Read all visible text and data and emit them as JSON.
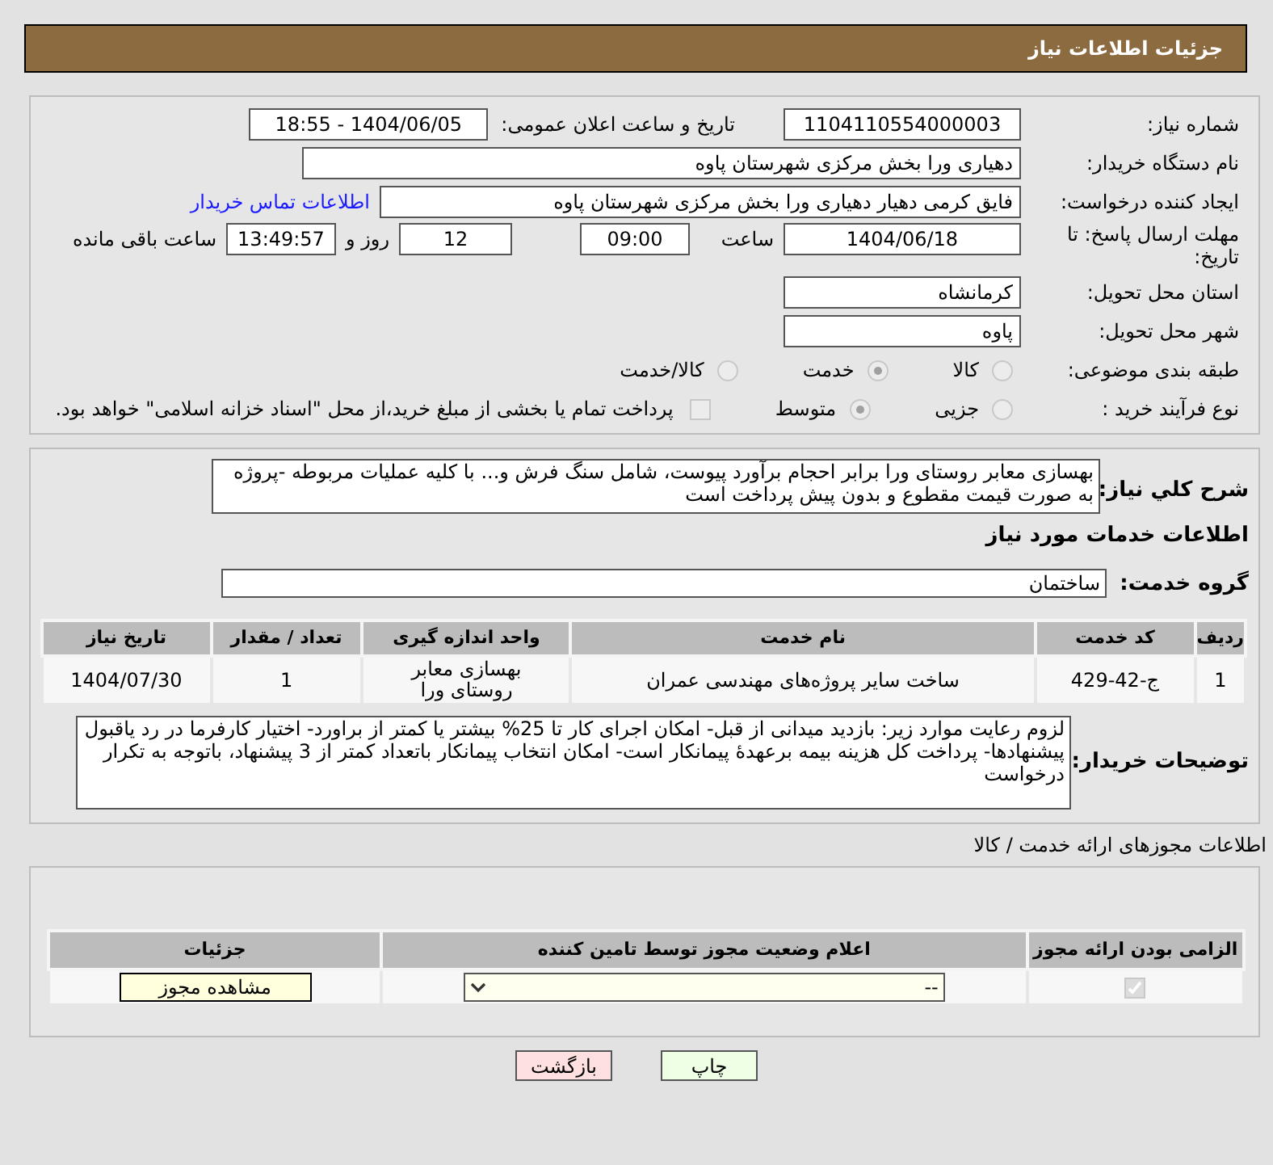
{
  "header": {
    "title": "جزئیات اطلاعات نیاز"
  },
  "need_number": {
    "label": "شماره نیاز:",
    "value": "1104110554000003"
  },
  "announce": {
    "label": "تاریخ و ساعت اعلان عمومی:",
    "value": "1404/06/05 - 18:55"
  },
  "buyer_org": {
    "label": "نام دستگاه خریدار:",
    "value": "دهیاری ورا بخش مرکزی شهرستان پاوه"
  },
  "requester": {
    "label": "ایجاد کننده درخواست:",
    "value": "فایق کرمی دهیار دهیاری ورا بخش مرکزی شهرستان پاوه",
    "link": "اطلاعات تماس خریدار"
  },
  "deadline": {
    "label": "مهلت ارسال پاسخ: تا تاریخ:",
    "date": "1404/06/18",
    "time_label": "ساعت",
    "time": "09:00",
    "days": "12",
    "days_label": "روز و",
    "remaining": "13:49:57",
    "remaining_label": "ساعت باقی مانده"
  },
  "province": {
    "label": "استان محل تحویل:",
    "value": "کرمانشاه"
  },
  "city": {
    "label": "شهر محل تحویل:",
    "value": "پاوه"
  },
  "category": {
    "label": "طبقه بندی موضوعی:",
    "options": [
      {
        "label": "کالا",
        "selected": false
      },
      {
        "label": "خدمت",
        "selected": true
      },
      {
        "label": "کالا/خدمت",
        "selected": false
      }
    ]
  },
  "process": {
    "label": "نوع فرآیند خرید :",
    "options": [
      {
        "label": "جزیی",
        "selected": false
      },
      {
        "label": "متوسط",
        "selected": true
      }
    ],
    "payment": {
      "label": "پرداخت تمام یا بخشی از مبلغ خرید،از محل \"اسناد خزانه اسلامی\" خواهد بود.",
      "checked": false
    }
  },
  "description": {
    "label": "شرح کلي نياز:",
    "value": "بهسازی معابر روستای ورا برابر احجام برآورد پیوست، شامل سنگ فرش و... با کلیه عملیات مربوطه -پروژه به صورت قیمت مقطوع و بدون پیش پرداخت است"
  },
  "services_heading": "اطلاعات خدمات مورد نیاز",
  "service_group": {
    "label": "گروه خدمت:",
    "value": "ساختمان"
  },
  "services_table": {
    "columns": [
      "ردیف",
      "کد خدمت",
      "نام خدمت",
      "واحد اندازه گیری",
      "تعداد / مقدار",
      "تاریخ نیاز"
    ],
    "rows": [
      [
        "1",
        "ج-42-429",
        "ساخت سایر پروژه‌های مهندسی عمران",
        "بهسازی معابر روستای ورا",
        "1",
        "1404/07/30"
      ]
    ]
  },
  "buyer_notes": {
    "label": "توضیحات خریدار:",
    "value": "لزوم رعایت موارد زیر: بازدید میدانی از قبل- امکان اجرای کار تا 25% بیشتر یا کمتر از براورد- اختیار کارفرما در رد یاقبول پیشنهادها- پرداخت کل هزینه بیمه برعهدهٔ پیمانکار است- امکان انتخاب پیمانکار باتعداد کمتر از 3 پیشنهاد، باتوجه به تکرار درخواست"
  },
  "permits_heading": "اطلاعات مجوزهای ارائه خدمت / کالا",
  "permits_table": {
    "columns": [
      "الزامی بودن ارائه مجوز",
      "اعلام وضعیت مجوز توسط تامین کننده",
      "جزئیات"
    ],
    "rows": [
      {
        "required": true,
        "status": "--",
        "details": "مشاهده مجوز"
      }
    ]
  },
  "buttons": [
    {
      "label": "چاپ",
      "kind": "print"
    },
    {
      "label": "بازگشت",
      "kind": "back"
    }
  ]
}
